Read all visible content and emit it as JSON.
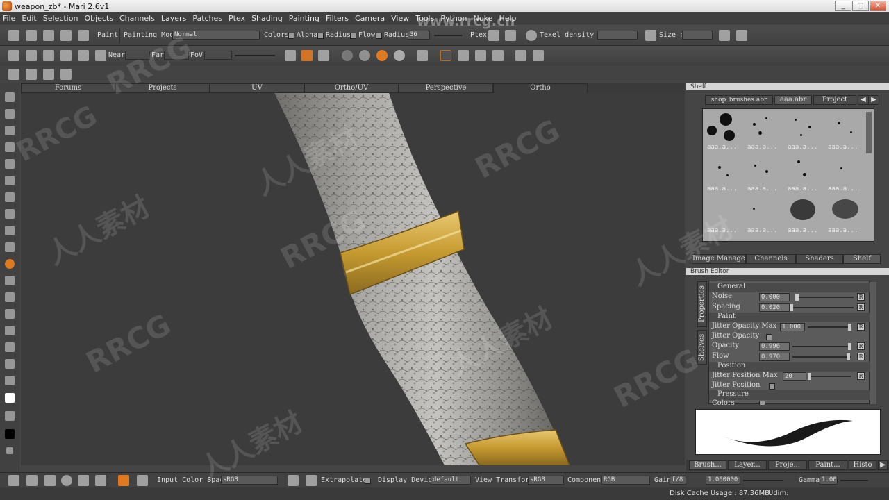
{
  "window": {
    "title": "weapon_zb* - Mari 2.6v1",
    "minimize": "_",
    "maximize": "□",
    "close": "✕"
  },
  "menu": [
    "File",
    "Edit",
    "Selection",
    "Objects",
    "Channels",
    "Layers",
    "Patches",
    "Ptex",
    "Shading",
    "Painting",
    "Filters",
    "Camera",
    "View",
    "Tools",
    "Python",
    "Nuke",
    "Help"
  ],
  "toolbar1": {
    "paint_label": "Paint",
    "painting_mode_label": "Painting Mode",
    "painting_mode_value": "Normal",
    "colors_label": "Colors",
    "alpha_label": "Alpha",
    "radius_label": "Radius",
    "flow_label": "Flow",
    "radius2_label": "Radius",
    "radius_value": "36",
    "ptex_label": "Ptex",
    "texel_density_label": "Texel density :",
    "size_label": "Size :"
  },
  "toolbar2": {
    "near_label": "Near",
    "far_label": "Far",
    "fov_label": "FoV"
  },
  "viewport_tabs": [
    "Forums",
    "Projects",
    "UV",
    "Ortho/UV",
    "Perspective",
    "Ortho"
  ],
  "viewport_active_tab": "Ortho",
  "shelf": {
    "panel_title": "Shelf",
    "tabs": [
      "shop_brushes.abr",
      "aaa.abr",
      "Project"
    ],
    "active_tab": "aaa.abr",
    "brush_label": "aaa.a..."
  },
  "panel_tabs": [
    "Image Manager",
    "Channels",
    "Shaders",
    "Shelf"
  ],
  "brush_editor": {
    "title": "Brush Editor",
    "side_tabs": [
      "Properties",
      "Shelves"
    ],
    "rows": [
      {
        "type": "group",
        "label": "General"
      },
      {
        "type": "value",
        "label": "Noise",
        "value": "0.000"
      },
      {
        "type": "value",
        "label": "Spacing",
        "value": "0.020"
      },
      {
        "type": "group",
        "label": "Paint"
      },
      {
        "type": "value",
        "label": "Jitter Opacity Max",
        "value": "1.000"
      },
      {
        "type": "check",
        "label": "Jitter Opacity"
      },
      {
        "type": "value",
        "label": "Opacity",
        "value": "0.996"
      },
      {
        "type": "value",
        "label": "Flow",
        "value": "0.970"
      },
      {
        "type": "group",
        "label": "Position"
      },
      {
        "type": "value",
        "label": "Jitter Position Max",
        "value": "20"
      },
      {
        "type": "check",
        "label": "Jitter Position"
      },
      {
        "type": "group",
        "label": "Pressure"
      },
      {
        "type": "check",
        "label": "Colors"
      }
    ],
    "reset_label": "R"
  },
  "bottom_tabs": [
    "Brush...",
    "Layer...",
    "Proje...",
    "Paint...",
    "Histo"
  ],
  "statusbar": {
    "input_color_space_label": "Input Color Space",
    "input_color_space_value": "sRGB",
    "extrapolate_label": "Extrapolate",
    "display_device_label": "Display Device",
    "display_device_value": "default",
    "view_transform_label": "View Transform",
    "view_transform_value": "sRGB",
    "component_label": "Component",
    "component_value": "RGB",
    "gain_label": "Gain",
    "gain_fstop": "f/8",
    "gain_value": "1.000000",
    "gamma_label": "Gamma",
    "gamma_value": "1.00"
  },
  "disk_cache": "Disk Cache Usage : 87.36MB",
  "udim_label": "Udim:",
  "watermarks": [
    "RRCG",
    "人人素材",
    "www.rrcg.cn"
  ],
  "colors": {
    "accent": "#e07a20",
    "gold": "#c9a53a",
    "stone": "#9a9a98"
  }
}
